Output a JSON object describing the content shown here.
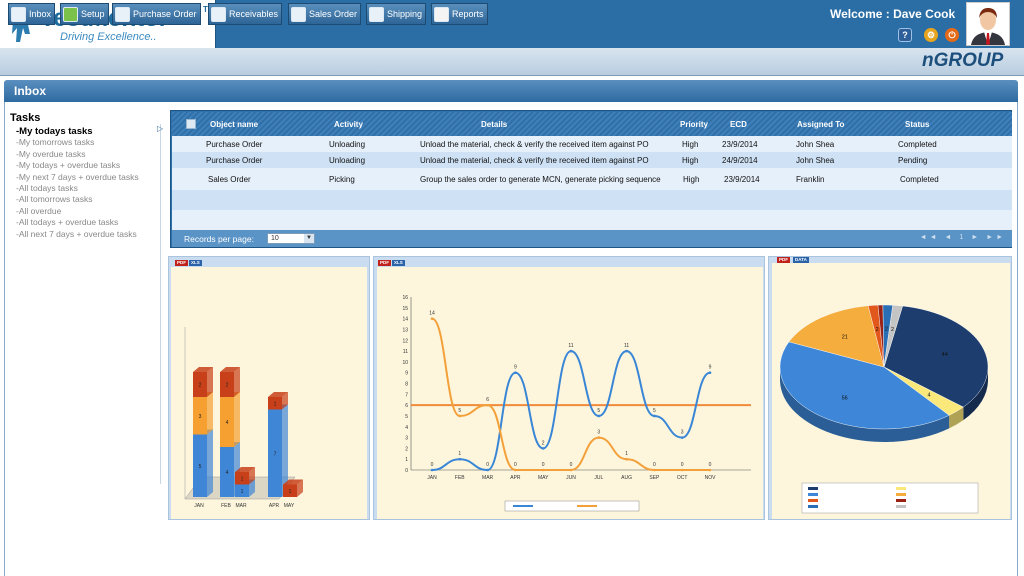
{
  "header": {
    "logo_title": "TestMentor",
    "logo_tm": "TM",
    "logo_tagline": "Driving Excellence..",
    "welcome": "Welcome : Dave Cook",
    "brand_right": "nGROUP",
    "help_glyph": "?"
  },
  "nav": {
    "items": [
      {
        "label": "Inbox",
        "icon": "envelope-icon"
      },
      {
        "label": "Setup",
        "icon": "gear-icon"
      },
      {
        "label": "Purchase Order",
        "icon": "document-icon"
      },
      {
        "label": "Receivables",
        "icon": "document-icon"
      },
      {
        "label": "Sales Order",
        "icon": "document-icon"
      },
      {
        "label": "Shipping",
        "icon": "document-icon"
      },
      {
        "label": "Reports",
        "icon": "bar-chart-icon"
      }
    ]
  },
  "inbox": {
    "title": "Inbox"
  },
  "tasks": {
    "heading": "Tasks",
    "items": [
      {
        "label": "-My todays tasks",
        "active": true
      },
      {
        "label": "-My tomorrows tasks"
      },
      {
        "label": "-My overdue tasks"
      },
      {
        "label": "-My todays + overdue tasks"
      },
      {
        "label": "-My next 7 days + overdue tasks"
      },
      {
        "label": "-All todays tasks"
      },
      {
        "label": "-All tomorrows tasks"
      },
      {
        "label": "-All overdue"
      },
      {
        "label": "-All todays + overdue tasks"
      },
      {
        "label": "-All next 7 days + overdue tasks"
      }
    ]
  },
  "grid": {
    "columns": [
      "Object name",
      "Activity",
      "Details",
      "Priority",
      "ECD",
      "Assigned To",
      "Status"
    ],
    "rows": [
      [
        "Purchase Order",
        "Unloading",
        "Unload the material, check & verify the received item against PO",
        "High",
        "23/9/2014",
        "John Shea",
        "Completed"
      ],
      [
        "Purchase Order",
        "Unloading",
        "Unload the material, check & verify the received item against PO",
        "High",
        "24/9/2014",
        "John Shea",
        "Pending"
      ],
      [
        "Sales Order",
        "Picking",
        "Group the sales order to generate MCN, generate picking sequence",
        "High",
        "23/9/2014",
        "Franklin",
        "Completed"
      ]
    ],
    "records_label": "Records per page:",
    "records_value": "10",
    "pager": "◄◄ ◄ 1 ► ►►"
  },
  "chart_badges": {
    "pdf": "PDF",
    "xls": "XLS",
    "data": "DATA"
  },
  "chart_data": [
    {
      "type": "bar",
      "title": "",
      "categories": [
        "JAN",
        "FEB",
        "MAR",
        "APR",
        "MAY"
      ],
      "stacked": true,
      "series": [
        {
          "values": [
            5,
            4,
            1,
            7,
            0
          ],
          "color": "#3f86d6"
        },
        {
          "values": [
            3,
            4,
            0,
            0,
            0
          ],
          "color": "#f5a030"
        },
        {
          "values": [
            2,
            2,
            1,
            1,
            1
          ],
          "color": "#c8401a"
        }
      ]
    },
    {
      "type": "line",
      "title": "",
      "x": [
        "JAN",
        "FEB",
        "MAR",
        "APR",
        "MAY",
        "JUN",
        "JUL",
        "AUG",
        "SEP",
        "OCT",
        "NOV"
      ],
      "ylim": [
        0,
        16
      ],
      "series": [
        {
          "values": [
            0,
            1,
            0,
            9,
            2,
            11,
            5,
            11,
            5,
            3,
            9
          ],
          "color": "#3a86d6"
        },
        {
          "values": [
            14,
            5,
            6,
            0,
            0,
            0,
            3,
            1,
            0,
            0,
            0
          ],
          "color": "#f4a03a"
        }
      ],
      "reference_line": {
        "value": 6,
        "color": "#f08a3a"
      }
    },
    {
      "type": "pie",
      "title": "",
      "slices": [
        {
          "value": 44,
          "color": "#1c3d6e"
        },
        {
          "value": 4,
          "color": "#fbe87a"
        },
        {
          "value": 56,
          "color": "#3d86d8"
        },
        {
          "value": 21,
          "color": "#f5ad3d"
        },
        {
          "value": 2,
          "color": "#e2581c"
        },
        {
          "value": 1,
          "color": "#9a2317"
        },
        {
          "value": 2,
          "color": "#2a6fb5"
        },
        {
          "value": 2,
          "color": "#c4c4c4"
        }
      ]
    }
  ]
}
